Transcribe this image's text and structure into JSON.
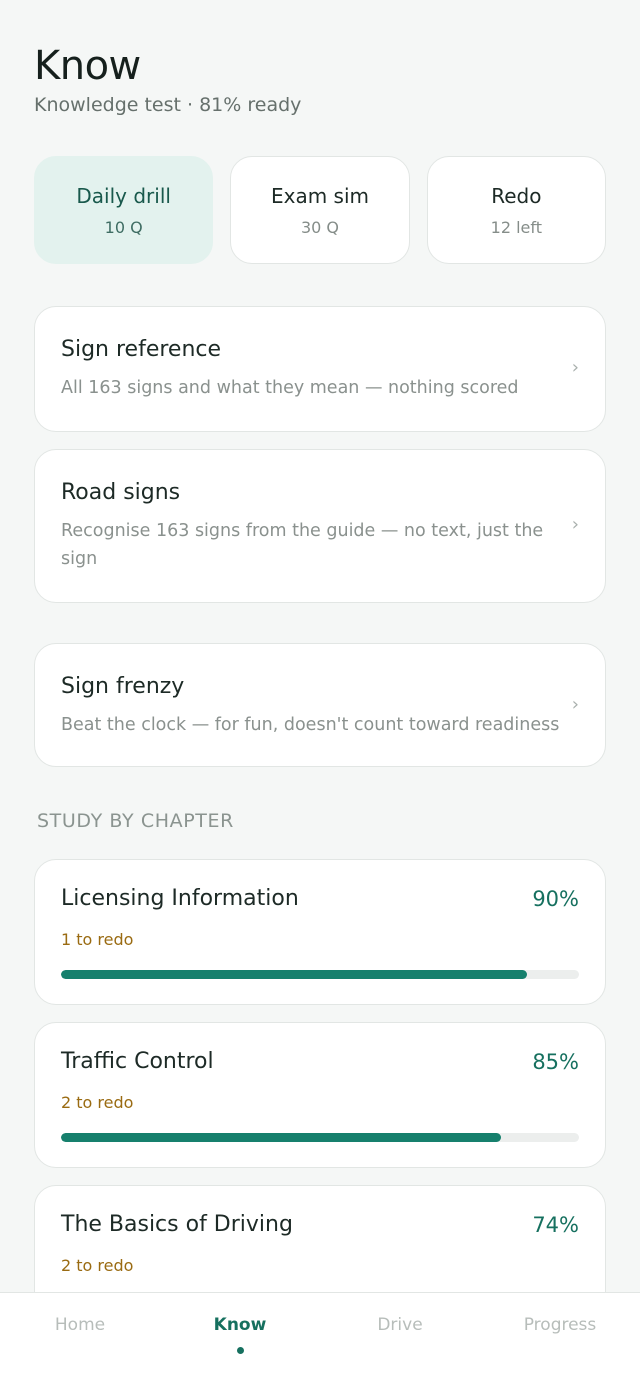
{
  "header": {
    "title": "Know",
    "subtitle": "Knowledge test · 81% ready"
  },
  "modes": [
    {
      "label": "Daily drill",
      "count": "10 Q",
      "active": true
    },
    {
      "label": "Exam sim",
      "count": "30 Q",
      "active": false
    },
    {
      "label": "Redo",
      "count": "12 left",
      "active": false
    }
  ],
  "cards": {
    "sign_reference": {
      "title": "Sign reference",
      "desc": "All 163 signs and what they mean — nothing scored",
      "chevron": "›"
    },
    "road_signs": {
      "title": "Road signs",
      "desc": "Recognise 163 signs from the guide — no text, just the sign",
      "chevron": "›"
    },
    "sign_frenzy": {
      "title": "Sign frenzy",
      "desc": "Beat the clock — for fun, doesn't count toward readiness",
      "chevron": "›"
    }
  },
  "section": {
    "label": "STUDY BY CHAPTER"
  },
  "chapters": [
    {
      "name": "Licensing Information",
      "pct": "90%",
      "progress": 0.9,
      "redo": "1 to redo"
    },
    {
      "name": "Traffic Control",
      "pct": "85%",
      "progress": 0.85,
      "redo": "2 to redo"
    },
    {
      "name": "The Basics of Driving",
      "pct": "74%",
      "progress": 0.74,
      "redo": "2 to redo"
    }
  ],
  "nav": {
    "items": [
      "Home",
      "Know",
      "Drive",
      "Progress"
    ],
    "active": "Know"
  },
  "colors": {
    "accent": "#16705f",
    "progress_fill": "#16806d",
    "redo_text": "#9a6b12",
    "active_mode_bg": "#e3f2ee"
  }
}
